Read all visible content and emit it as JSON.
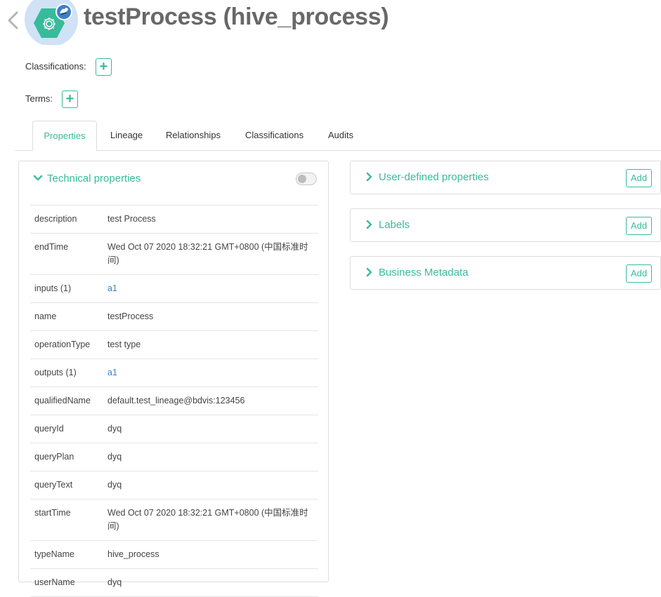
{
  "header": {
    "back_icon": "chevron-left-icon",
    "entity_icon": "process-gear-icon",
    "title": "testProcess (hive_process)"
  },
  "meta": {
    "classifications_label": "Classifications:",
    "terms_label": "Terms:",
    "add_symbol": "+"
  },
  "tabs": [
    {
      "label": "Properties",
      "active": true
    },
    {
      "label": "Lineage"
    },
    {
      "label": "Relationships"
    },
    {
      "label": "Classifications"
    },
    {
      "label": "Audits"
    }
  ],
  "technical": {
    "title": "Technical properties",
    "toggle_on": false,
    "rows": [
      {
        "key": "description",
        "value": "test Process"
      },
      {
        "key": "endTime",
        "value": "Wed Oct 07 2020 18:32:21 GMT+0800 (中国标准时间)"
      },
      {
        "key": "inputs (1)",
        "value": "a1",
        "link": true
      },
      {
        "key": "name",
        "value": "testProcess"
      },
      {
        "key": "operationType",
        "value": "test type"
      },
      {
        "key": "outputs (1)",
        "value": "a1",
        "link": true
      },
      {
        "key": "qualifiedName",
        "value": "default.test_lineage@bdvis:123456"
      },
      {
        "key": "queryId",
        "value": "dyq"
      },
      {
        "key": "queryPlan",
        "value": "dyq"
      },
      {
        "key": "queryText",
        "value": "dyq"
      },
      {
        "key": "startTime",
        "value": "Wed Oct 07 2020 18:32:21 GMT+0800 (中国标准时间)"
      },
      {
        "key": "typeName",
        "value": "hive_process"
      },
      {
        "key": "userName",
        "value": "dyq"
      }
    ]
  },
  "side_panels": [
    {
      "title": "User-defined properties",
      "button": "Add"
    },
    {
      "title": "Labels",
      "button": "Add"
    },
    {
      "title": "Business Metadata",
      "button": "Add"
    }
  ],
  "colors": {
    "accent": "#37bb9b",
    "link": "#3a82c4",
    "title": "#686868",
    "border": "#dddddd"
  }
}
